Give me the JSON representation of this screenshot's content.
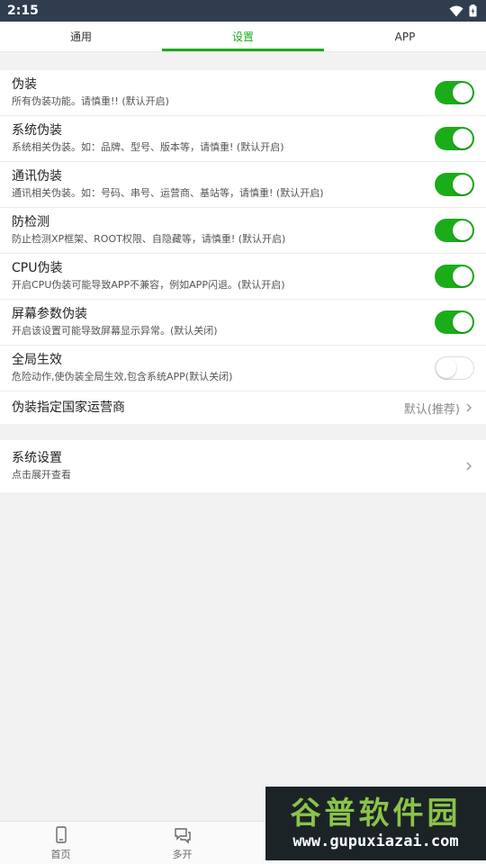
{
  "status": {
    "time": "2:15"
  },
  "tabs": [
    {
      "label": "通用",
      "active": false
    },
    {
      "label": "设置",
      "active": true
    },
    {
      "label": "APP",
      "active": false
    }
  ],
  "settings": {
    "items": [
      {
        "title": "伪装",
        "sub": "所有伪装功能。请慎重!! (默认开启)",
        "on": true
      },
      {
        "title": "系统伪装",
        "sub": "系统相关伪装。如：品牌、型号、版本等，请慎重! (默认开启)",
        "on": true
      },
      {
        "title": "通讯伪装",
        "sub": "通讯相关伪装。如：号码、串号、运营商、基站等，请慎重! (默认开启)",
        "on": true
      },
      {
        "title": "防检测",
        "sub": "防止检测XP框架、ROOT权限、自隐藏等，请慎重! (默认开启)",
        "on": true
      },
      {
        "title": "CPU伪装",
        "sub": "开启CPU伪装可能导致APP不兼容，例如APP闪退。(默认开启)",
        "on": true
      },
      {
        "title": "屏幕参数伪装",
        "sub": "开启该设置可能导致屏幕显示异常。(默认关闭)",
        "on": true
      },
      {
        "title": "全局生效",
        "sub": "危险动作,使伪装全局生效,包含系统APP(默认关闭)",
        "on": false
      }
    ],
    "carrier": {
      "title": "伪装指定国家运营商",
      "value": "默认(推荐)"
    }
  },
  "system": {
    "title": "系统设置",
    "sub": "点击展开查看"
  },
  "bottomnav": [
    {
      "label": "首页",
      "icon": "phone-icon"
    },
    {
      "label": "多开",
      "icon": "chat-icon"
    }
  ],
  "watermark": {
    "line1": "谷普软件园",
    "line2": "www.gupuxiazai.com"
  },
  "colors": {
    "accent": "#1aad19",
    "statusbar": "#2f3d4f"
  }
}
